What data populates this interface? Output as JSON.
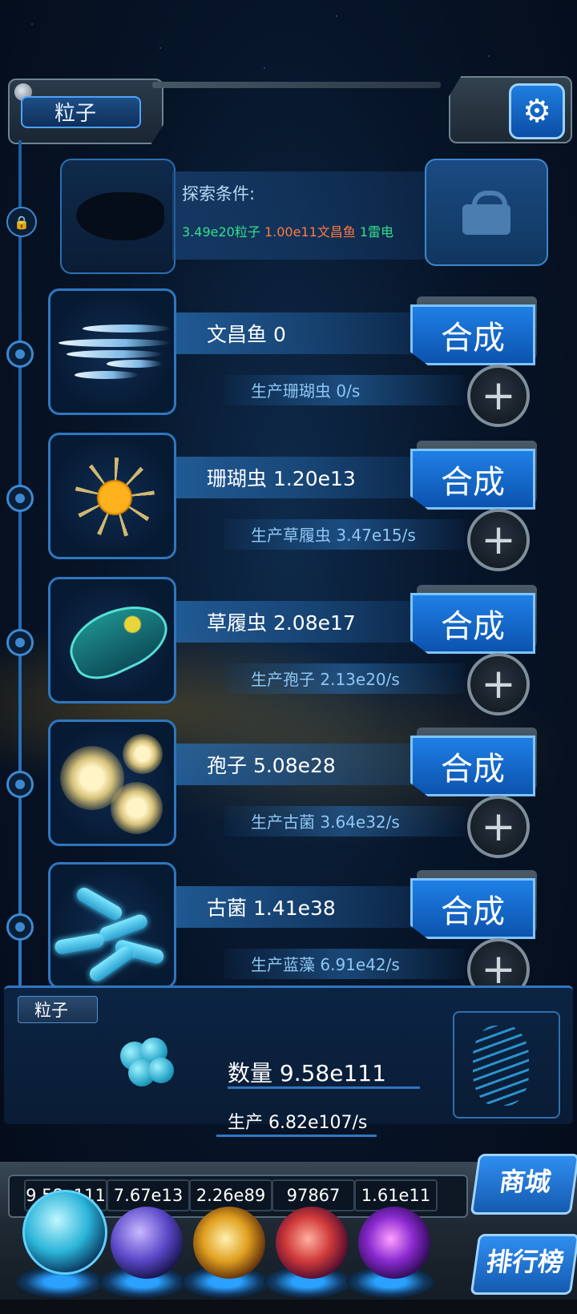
{
  "header": {
    "tab_title": "粒子",
    "settings_icon": "gear-icon"
  },
  "locked": {
    "label": "探索条件:",
    "req1": "3.49e20粒子",
    "req2": "1.00e11文昌鱼",
    "req3": "1雷电"
  },
  "rows": [
    {
      "name": "文昌鱼 0",
      "production": "生产珊瑚虫 0/s",
      "synth": "合成"
    },
    {
      "name": "珊瑚虫 1.20e13",
      "production": "生产草履虫 3.47e15/s",
      "synth": "合成"
    },
    {
      "name": "草履虫 2.08e17",
      "production": "生产孢子 2.13e20/s",
      "synth": "合成"
    },
    {
      "name": "孢子 5.08e28",
      "production": "生产古菌 3.64e32/s",
      "synth": "合成"
    },
    {
      "name": "古菌 1.41e38",
      "production": "生产蓝藻 6.91e42/s",
      "synth": "合成"
    }
  ],
  "info": {
    "tab": "粒子",
    "count": "数量 9.58e111",
    "rate": "生产 6.82e107/s"
  },
  "dock": {
    "stats": [
      "9.58e111",
      "7.67e13",
      "2.26e89",
      "97867",
      "1.61e11"
    ],
    "shop": "商城",
    "ranking": "排行榜"
  }
}
